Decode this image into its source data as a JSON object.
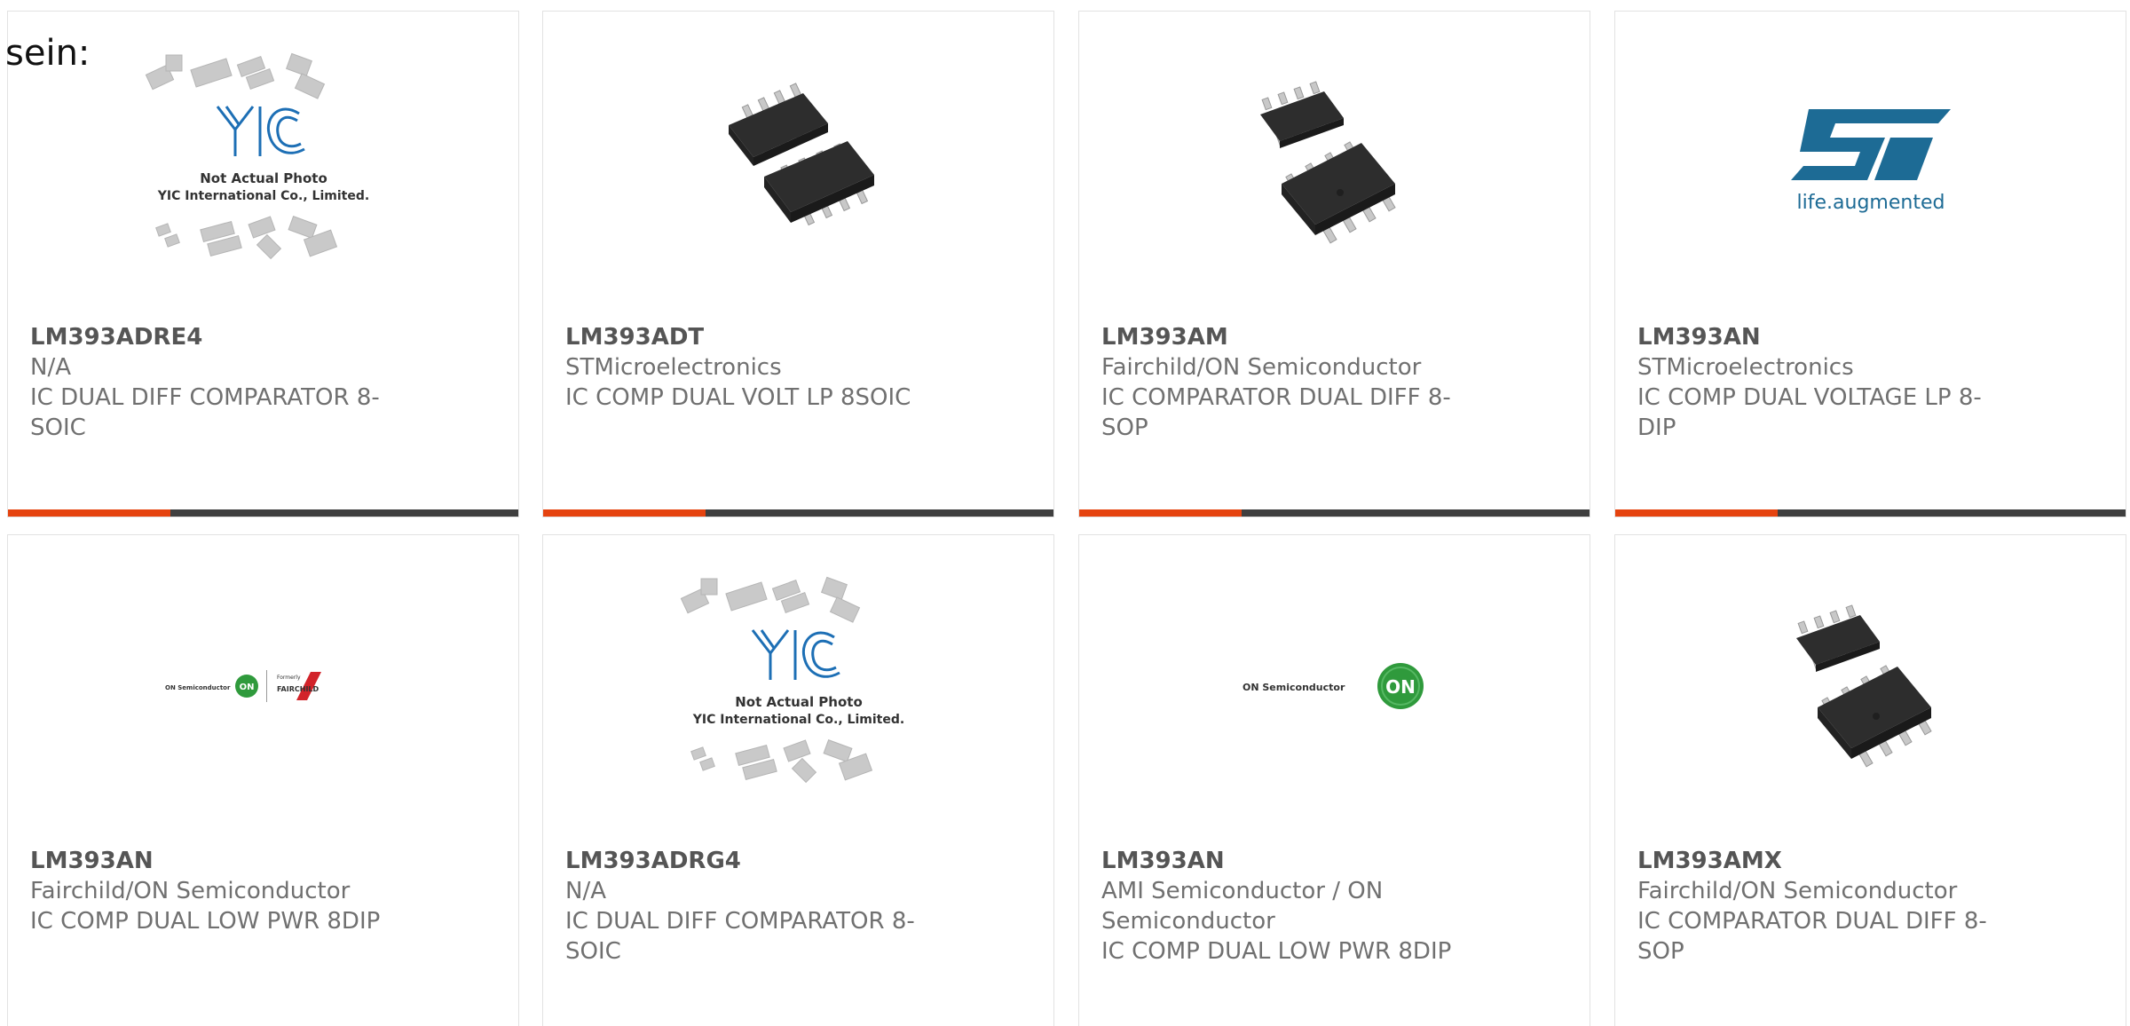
{
  "header": {
    "label": "sein:"
  },
  "placeholder_image": {
    "line1": "Not Actual Photo",
    "line2": "YIC International Co., Limited."
  },
  "logos": {
    "st_tagline": "life.augmented",
    "on_text": "ON Semiconductor",
    "fairchild_text": "FAIRCHILD",
    "formerly_text": "Formerly"
  },
  "colors": {
    "accent": "#e5430f",
    "bar": "#3f3f3f",
    "st_blue": "#1d6b95",
    "on_green": "#2f9a3c",
    "yic_blue": "#1d6fb5"
  },
  "products": [
    {
      "part": "LM393ADRE4",
      "manufacturer": "N/A",
      "description": "IC DUAL DIFF COMPARATOR 8-SOIC",
      "image": "yic-placeholder"
    },
    {
      "part": "LM393ADT",
      "manufacturer": "STMicroelectronics",
      "description": "IC COMP DUAL VOLT LP 8SOIC",
      "image": "soic-chip-photo"
    },
    {
      "part": "LM393AM",
      "manufacturer": "Fairchild/ON Semiconductor",
      "description": "IC COMPARATOR DUAL DIFF 8-SOP",
      "image": "soic-chip-photo"
    },
    {
      "part": "LM393AN",
      "manufacturer": "STMicroelectronics",
      "description": "IC COMP DUAL VOLTAGE LP 8-DIP",
      "image": "st-logo"
    },
    {
      "part": "LM393AN",
      "manufacturer": "Fairchild/ON Semiconductor",
      "description": "IC COMP DUAL LOW PWR 8DIP",
      "image": "on-fairchild-logo"
    },
    {
      "part": "LM393ADRG4",
      "manufacturer": "N/A",
      "description": "IC DUAL DIFF COMPARATOR 8-SOIC",
      "image": "yic-placeholder"
    },
    {
      "part": "LM393AN",
      "manufacturer": "AMI Semiconductor / ON Semiconductor",
      "description": "IC COMP DUAL LOW PWR 8DIP",
      "image": "on-logo"
    },
    {
      "part": "LM393AMX",
      "manufacturer": "Fairchild/ON Semiconductor",
      "description": "IC COMPARATOR DUAL DIFF 8-SOP",
      "image": "soic-chip-photo"
    }
  ]
}
